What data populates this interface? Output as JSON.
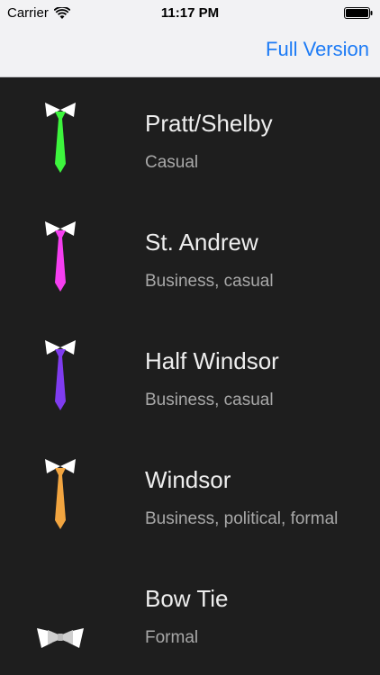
{
  "status_bar": {
    "carrier": "Carrier",
    "time": "11:17 PM",
    "icons": [
      "wifi-icon",
      "battery-icon"
    ]
  },
  "nav": {
    "full_version_label": "Full Version",
    "accent_color": "#1d7bf5"
  },
  "knots": [
    {
      "title": "Pratt/Shelby",
      "subtitle": "Casual",
      "icon": "green-tie-icon",
      "color": "#3df53d"
    },
    {
      "title": "St. Andrew",
      "subtitle": "Business, casual",
      "icon": "pink-tie-icon",
      "color": "#f53ef0"
    },
    {
      "title": "Half Windsor",
      "subtitle": "Business, casual",
      "icon": "purple-tie-icon",
      "color": "#7f3cf0"
    },
    {
      "title": "Windsor",
      "subtitle": "Business, political, formal",
      "icon": "orange-tie-icon",
      "color": "#f2a540"
    },
    {
      "title": "Bow Tie",
      "subtitle": "Formal",
      "icon": "bow-tie-icon",
      "color": "#cfcfcf"
    }
  ],
  "background_color": "#1e1e1e"
}
